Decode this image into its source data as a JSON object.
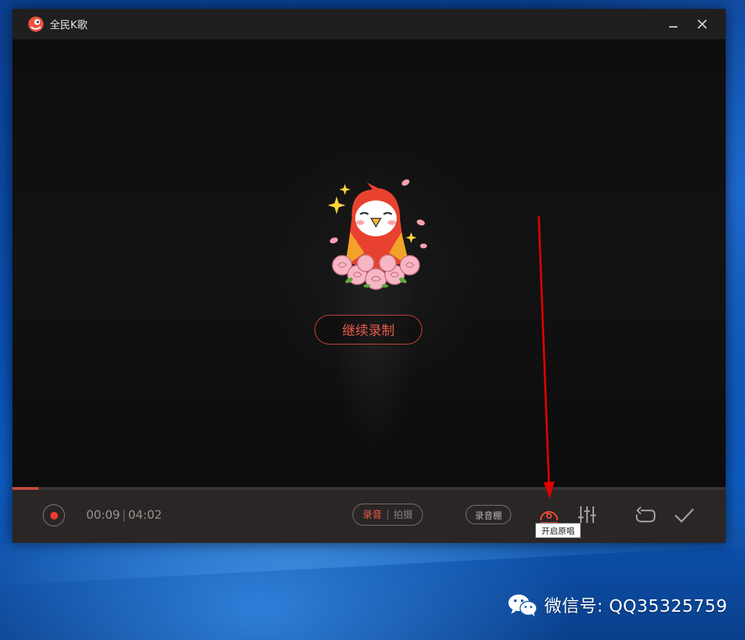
{
  "window": {
    "title": "全民K歌",
    "minimize_icon": "minimize-icon",
    "close_icon": "close-icon"
  },
  "video": {
    "continue_label": "继续录制"
  },
  "player": {
    "progress": 0.037,
    "current_time": "00:09",
    "separator": "|",
    "total_time": "04:02",
    "mode_audio": "录音",
    "mode_separator": "|",
    "mode_video": "拍摄",
    "studio_label": "录音棚",
    "original_vocal_icon": "original-vocal-icon",
    "equalizer_icon": "equalizer-icon",
    "restart_icon": "restart-icon",
    "finish_icon": "checkmark-icon"
  },
  "tooltip": {
    "text": "开启原唱"
  },
  "watermark": {
    "text": "微信号: QQ35325759"
  },
  "colors": {
    "accent_red": "#ef3b34",
    "annotation_arrow": "#e00000"
  }
}
